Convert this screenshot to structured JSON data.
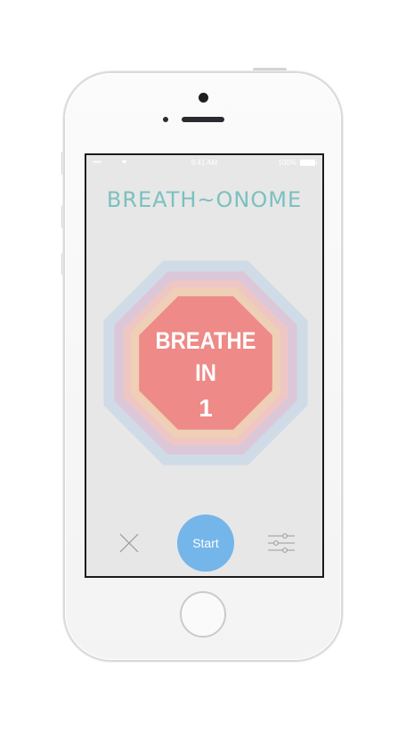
{
  "status_bar": {
    "signal": "•••••",
    "time": "9:41 AM",
    "battery": "100%"
  },
  "app": {
    "title": "BREATH~ONOME",
    "prompt_line1": "BREATHE",
    "prompt_line2": "IN",
    "count": "1"
  },
  "controls": {
    "close_icon": "close-icon",
    "start_label": "Start",
    "settings_icon": "sliders-icon"
  },
  "colors": {
    "title": "#7cc0c0",
    "start_button": "#74b5ea",
    "octagon_outer": "#d0dbe8",
    "octagon_2": "#dcc7d8",
    "octagon_3": "#eec7c4",
    "octagon_4": "#efcfb6",
    "octagon_inner": "#ee8a87"
  }
}
